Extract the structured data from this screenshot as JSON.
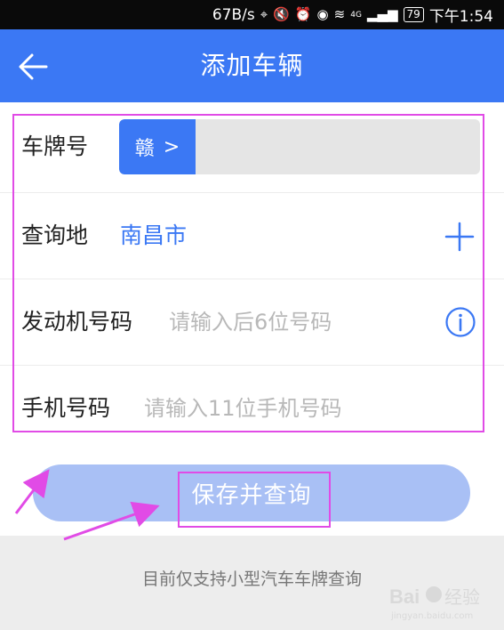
{
  "status_bar": {
    "speed": "67B/s",
    "battery": "79",
    "time": "下午1:54",
    "network": "4G"
  },
  "app_bar": {
    "title": "添加车辆",
    "back_icon": "arrow-left-icon"
  },
  "form": {
    "plate": {
      "label": "车牌号",
      "prefix": "赣",
      "prefix_chevron": ">"
    },
    "location": {
      "label": "查询地",
      "value": "南昌市",
      "action_icon": "plus-icon"
    },
    "engine": {
      "label": "发动机号码",
      "placeholder": "请输入后6位号码",
      "action_icon": "info-icon"
    },
    "phone": {
      "label": "手机号码",
      "placeholder": "请输入11位手机号码"
    }
  },
  "save_button": {
    "label": "保存并查询"
  },
  "footer": {
    "note": "目前仅支持小型汽车车牌查询"
  },
  "watermark": {
    "text": "Baidu经验",
    "sub": "jingyan.baidu.com"
  },
  "colors": {
    "primary": "#3b78f4",
    "button_disabled": "#a9c0f5",
    "highlight": "#e14be6",
    "placeholder": "#b8b8b8"
  }
}
